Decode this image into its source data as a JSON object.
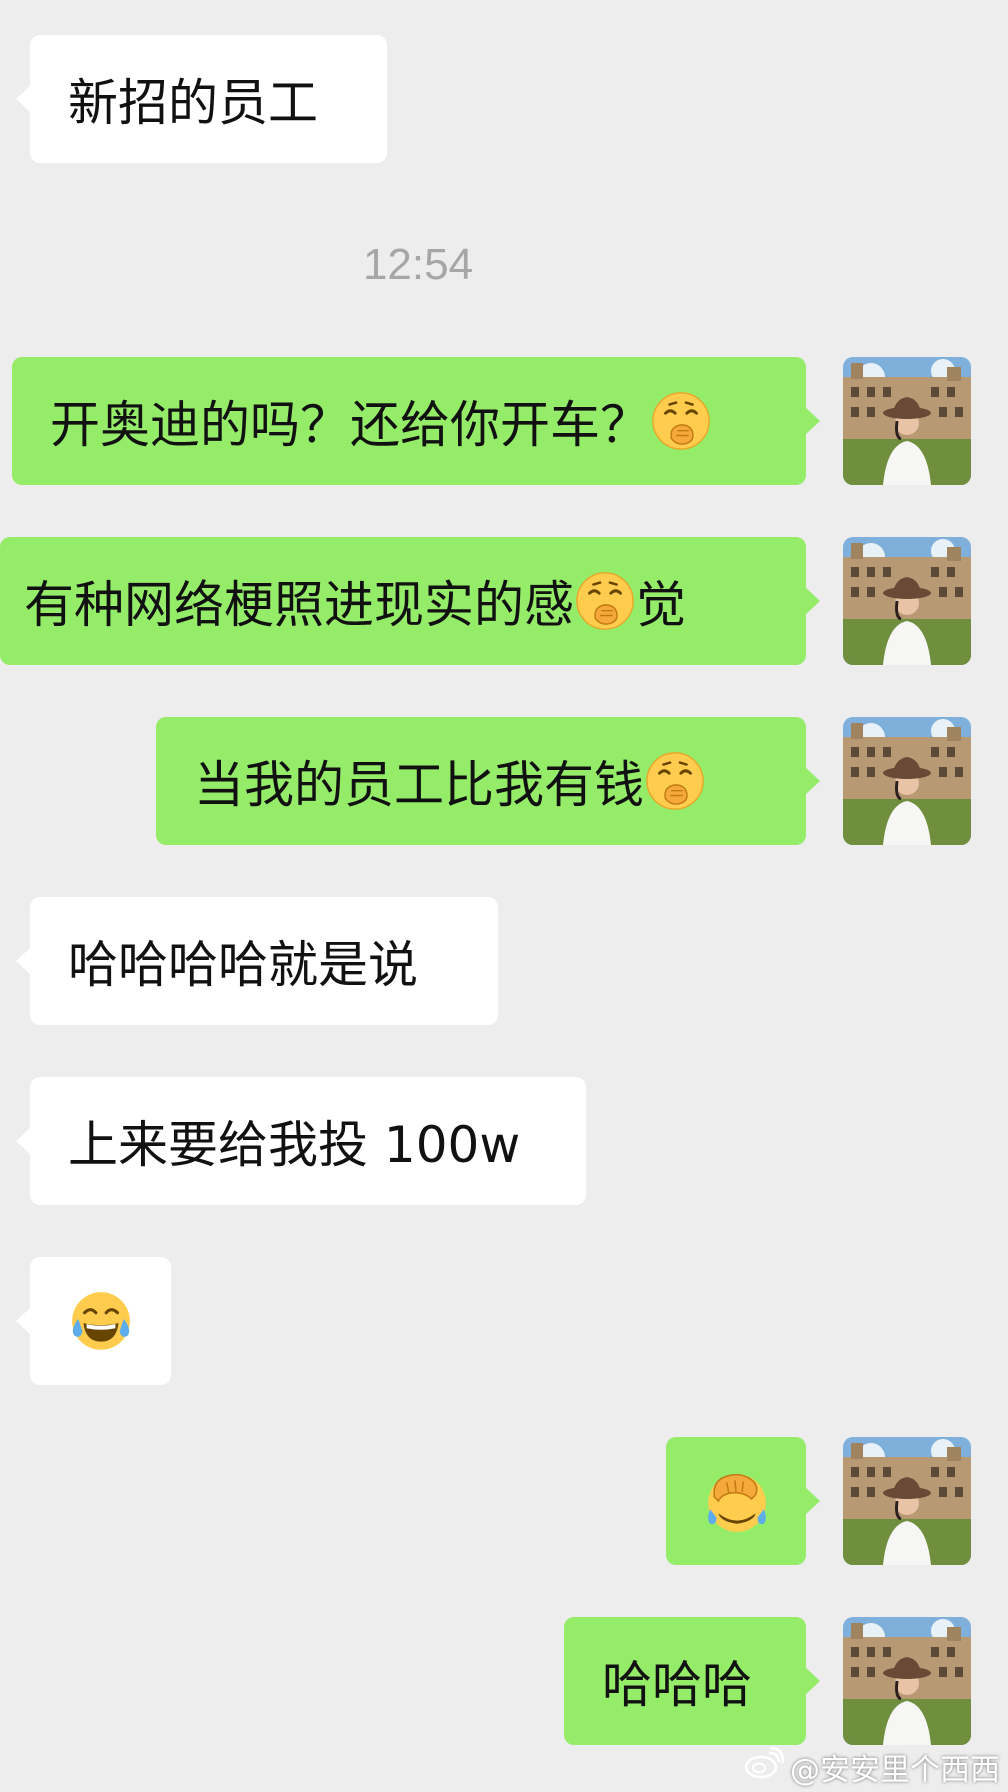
{
  "timestamp": "12:54",
  "messages": [
    {
      "side": "incoming",
      "text": "新招的员工"
    },
    {
      "side": "outgoing",
      "text": "开奥迪的吗？还给你开车？",
      "trailing_emoji": "thinking-face-hand-over-mouth"
    },
    {
      "side": "outgoing",
      "text_before": "有种网络梗照进现实的感",
      "inline_emoji": "thinking-face-hand-over-mouth",
      "text_after": "觉"
    },
    {
      "side": "outgoing",
      "text": "当我的员工比我有钱",
      "trailing_emoji": "thinking-face-hand-over-mouth"
    },
    {
      "side": "incoming",
      "text": "哈哈哈哈就是说"
    },
    {
      "side": "incoming",
      "text": "上来要给我投 100w"
    },
    {
      "side": "incoming",
      "emoji": "tears-of-joy-face"
    },
    {
      "side": "outgoing",
      "emoji": "facepalm-face"
    },
    {
      "side": "outgoing",
      "text": "哈哈哈"
    }
  ],
  "watermark": {
    "icon": "weibo-logo-icon",
    "text": "@安安里个西西"
  },
  "colors": {
    "background": "#ededed",
    "incoming_bubble": "#ffffff",
    "outgoing_bubble": "#95ec69",
    "timestamp_text": "#a6a6a6"
  }
}
